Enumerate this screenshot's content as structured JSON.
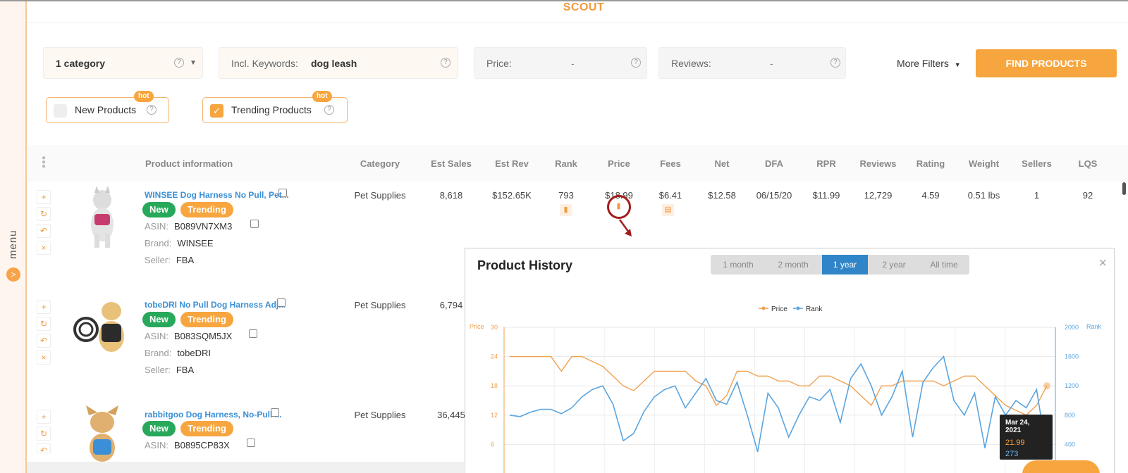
{
  "app": {
    "title": "SCOUT",
    "menu_label": "menu",
    "menu_arrow": ">"
  },
  "filters": {
    "category": {
      "value": "1  category"
    },
    "keywords": {
      "label": "Incl. Keywords:",
      "value": "dog leash"
    },
    "price": {
      "label": "Price:",
      "value": "-"
    },
    "reviews": {
      "label": "Reviews:",
      "value": "-"
    },
    "more_filters": "More Filters",
    "find_button": "FIND PRODUCTS",
    "help_glyph": "?"
  },
  "toggles": {
    "new_products": {
      "label": "New Products",
      "checked": false,
      "hot": "hot"
    },
    "trending_products": {
      "label": "Trending Products",
      "checked": true,
      "hot": "hot"
    }
  },
  "table": {
    "headers": [
      "Product information",
      "Category",
      "Est Sales",
      "Est Rev",
      "Rank",
      "Price",
      "Fees",
      "Net",
      "DFA",
      "RPR",
      "Reviews",
      "Rating",
      "Weight",
      "Sellers",
      "LQS"
    ],
    "labels": {
      "asin": "ASIN:",
      "brand": "Brand:",
      "seller": "Seller:",
      "new": "New",
      "trending": "Trending"
    },
    "rows": [
      {
        "title": "WINSEE Dog Harness No Pull, Pet...",
        "asin": "B089VN7XM3",
        "brand": "WINSEE",
        "seller": "FBA",
        "category": "Pet Supplies",
        "est_sales": "8,618",
        "est_rev": "$152.65K",
        "rank": "793",
        "price": "$18.99",
        "fees": "$6.41",
        "net": "$12.58",
        "dfa": "06/15/20",
        "rpr": "$11.99",
        "reviews": "12,729",
        "rating": "4.59",
        "weight": "0.51 lbs",
        "sellers": "1",
        "lqs": "92"
      },
      {
        "title": "tobeDRI No Pull Dog Harness Adj...",
        "asin": "B083SQM5JX",
        "brand": "tobeDRI",
        "seller": "FBA",
        "category": "Pet Supplies",
        "est_sales": "6,794"
      },
      {
        "title": "rabbitgoo Dog Harness, No-Pull ...",
        "asin": "B0895CP83X",
        "category": "Pet Supplies",
        "est_sales": "36,445"
      }
    ]
  },
  "history": {
    "title": "Product History",
    "ranges": [
      "1 month",
      "2 month",
      "1 year",
      "2 year",
      "All time"
    ],
    "active_range": "1 year",
    "close": "×",
    "tooltip": {
      "date": "Mar 24, 2021",
      "price": "21.99",
      "rank": "273"
    }
  },
  "chart_data": {
    "type": "line",
    "legend": [
      "Price",
      "Rank"
    ],
    "legend_position": "top-center",
    "y_left": {
      "label": "Price",
      "ticks": [
        "30",
        "24",
        "18",
        "12",
        "6"
      ],
      "range": [
        0,
        30
      ]
    },
    "y_right": {
      "label": "Rank",
      "ticks": [
        "2000",
        "1600",
        "1200",
        "800",
        "400"
      ],
      "range": [
        0,
        2000
      ]
    },
    "grid": true,
    "series": [
      {
        "name": "Price",
        "color": "#f0a050",
        "values": [
          24,
          24,
          24,
          24,
          24,
          21,
          24,
          24,
          23,
          22,
          20,
          18,
          17,
          19,
          21,
          21,
          21,
          21,
          19,
          18,
          14,
          16,
          21,
          21,
          20,
          20,
          19,
          19,
          18,
          18,
          20,
          20,
          19,
          18,
          16,
          14,
          18,
          18,
          19,
          19,
          19,
          19,
          18,
          19,
          20,
          20,
          18,
          16,
          14,
          13,
          12,
          14,
          18
        ]
      },
      {
        "name": "Rank",
        "color": "#5aa5e0",
        "values": [
          800,
          780,
          840,
          880,
          880,
          820,
          900,
          1050,
          1150,
          1200,
          950,
          450,
          550,
          850,
          1050,
          1150,
          1200,
          900,
          1100,
          1300,
          1000,
          950,
          1250,
          800,
          300,
          1100,
          900,
          500,
          800,
          1050,
          1000,
          1150,
          700,
          1300,
          1500,
          1200,
          800,
          1050,
          1400,
          500,
          1250,
          1450,
          1600,
          1000,
          800,
          1100,
          350,
          1050,
          800,
          1000,
          900,
          1150,
          273
        ]
      }
    ]
  },
  "colors": {
    "accent": "#f7a53e",
    "link": "#3a8fd6",
    "new_badge": "#27a85a",
    "active_tab": "#2f85c7"
  }
}
